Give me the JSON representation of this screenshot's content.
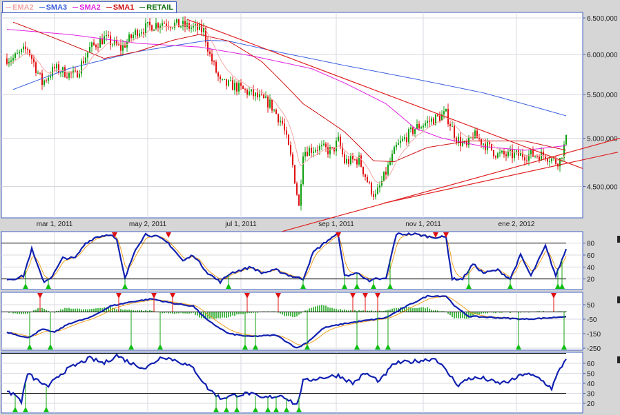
{
  "legend": [
    {
      "label": "EMA2",
      "color": "#f4a6a6"
    },
    {
      "label": "SMA3",
      "color": "#3a5ee0"
    },
    {
      "label": "SMA2",
      "color": "#e020e0"
    },
    {
      "label": "SMA1",
      "color": "#d01010"
    },
    {
      "label": "RETAIL",
      "color": "#107010"
    }
  ],
  "chart_data": [
    {
      "type": "candlestick",
      "title": "RETAIL",
      "yscale": "log",
      "ylim": [
        4200000,
        6580000
      ],
      "yticks": [
        {
          "v": 6500000,
          "label": "6.500,000"
        },
        {
          "v": 6000000,
          "label": "6.000,000"
        },
        {
          "v": 5500000,
          "label": "5.500,000"
        },
        {
          "v": 5000000,
          "label": "5.000,000"
        },
        {
          "v": 4500000,
          "label": "4.500,000"
        }
      ],
      "xticks": [
        {
          "at": 23,
          "label": "mar 1, 2011"
        },
        {
          "at": 68,
          "label": "may 2, 2011"
        },
        {
          "at": 113,
          "label": "jul 1, 2011"
        },
        {
          "at": 159,
          "label": "sep 1, 2011"
        },
        {
          "at": 201,
          "label": "nov 1, 2011"
        },
        {
          "at": 246,
          "label": "ene 2, 2012"
        }
      ],
      "bars": 270,
      "price_path": [
        [
          0,
          5950000
        ],
        [
          3,
          5950000
        ],
        [
          10,
          6080000
        ],
        [
          17,
          5640000
        ],
        [
          23,
          5820000
        ],
        [
          33,
          5730000
        ],
        [
          40,
          6080000
        ],
        [
          47,
          6220000
        ],
        [
          55,
          6080000
        ],
        [
          63,
          6320000
        ],
        [
          75,
          6440000
        ],
        [
          87,
          6380000
        ],
        [
          95,
          6320000
        ],
        [
          98,
          5990000
        ],
        [
          103,
          5640000
        ],
        [
          110,
          5600000
        ],
        [
          117,
          5520000
        ],
        [
          127,
          5390000
        ],
        [
          133,
          5160000
        ],
        [
          138,
          4710000
        ],
        [
          141,
          4300000
        ],
        [
          143,
          4860000
        ],
        [
          150,
          4900000
        ],
        [
          157,
          4860000
        ],
        [
          160,
          4970000
        ],
        [
          163,
          4750000
        ],
        [
          170,
          4770000
        ],
        [
          175,
          4500000
        ],
        [
          178,
          4400000
        ],
        [
          183,
          4640000
        ],
        [
          188,
          4900000
        ],
        [
          197,
          5110000
        ],
        [
          205,
          5200000
        ],
        [
          212,
          5270000
        ],
        [
          217,
          5000000
        ],
        [
          222,
          4900000
        ],
        [
          225,
          5040000
        ],
        [
          237,
          4820000
        ],
        [
          250,
          4820000
        ],
        [
          260,
          4820000
        ],
        [
          265,
          4750000
        ],
        [
          267,
          4770000
        ],
        [
          270,
          4980000
        ]
      ],
      "series": [
        {
          "name": "SMA3",
          "color": "#3a5ee0",
          "points": [
            [
              3,
              5560000
            ],
            [
              30,
              5820000
            ],
            [
              63,
              6040000
            ],
            [
              97,
              6190000
            ],
            [
              107,
              6180000
            ],
            [
              130,
              6040000
            ],
            [
              163,
              5860000
            ],
            [
              197,
              5690000
            ],
            [
              230,
              5520000
            ],
            [
              270,
              5250000
            ]
          ]
        },
        {
          "name": "SMA2",
          "color": "#e020e0",
          "points": [
            [
              0,
              6340000
            ],
            [
              30,
              6270000
            ],
            [
              63,
              6150000
            ],
            [
              93,
              6100000
            ],
            [
              117,
              5990000
            ],
            [
              147,
              5820000
            ],
            [
              163,
              5640000
            ],
            [
              183,
              5390000
            ],
            [
              197,
              5110000
            ],
            [
              210,
              5000000
            ],
            [
              230,
              4910000
            ],
            [
              250,
              4870000
            ],
            [
              270,
              4920000
            ]
          ]
        },
        {
          "name": "SMA1",
          "color": "#d01010",
          "points": [
            [
              3,
              6440000
            ],
            [
              23,
              6220000
            ],
            [
              47,
              5950000
            ],
            [
              63,
              6040000
            ],
            [
              80,
              6190000
            ],
            [
              93,
              6270000
            ],
            [
              107,
              6180000
            ],
            [
              123,
              5910000
            ],
            [
              143,
              5390000
            ],
            [
              163,
              5070000
            ],
            [
              177,
              4760000
            ],
            [
              187,
              4750000
            ],
            [
              203,
              4900000
            ],
            [
              223,
              4970000
            ],
            [
              250,
              4970000
            ],
            [
              270,
              4870000
            ]
          ]
        },
        {
          "name": "EMA2",
          "color": "#f4a6a6",
          "computed_from": "price_path",
          "period": 10
        }
      ],
      "trendlines": [
        {
          "from": [
            87,
            6480000
          ],
          "to": [
            278,
            4680000
          ],
          "color": "#e02020"
        },
        {
          "from": [
            133,
            4080000
          ],
          "to": [
            296,
            5000000
          ],
          "color": "#e02020"
        },
        {
          "from": [
            182,
            4340000
          ],
          "to": [
            295,
            4850000
          ],
          "color": "#e02020"
        }
      ]
    },
    {
      "type": "line",
      "name": "oscillator-1",
      "ylim": [
        0,
        100
      ],
      "yticks": [
        {
          "v": 80,
          "label": "80"
        },
        {
          "v": 60,
          "label": "60"
        },
        {
          "v": 40,
          "label": "40"
        },
        {
          "v": 20,
          "label": "20"
        }
      ],
      "hlines": [
        80,
        20
      ],
      "points": [
        [
          0,
          20
        ],
        [
          3,
          20
        ],
        [
          8,
          25
        ],
        [
          12,
          70
        ],
        [
          15,
          40
        ],
        [
          18,
          15
        ],
        [
          22,
          25
        ],
        [
          27,
          55
        ],
        [
          33,
          55
        ],
        [
          38,
          80
        ],
        [
          43,
          90
        ],
        [
          50,
          95
        ],
        [
          53,
          85
        ],
        [
          57,
          20
        ],
        [
          62,
          70
        ],
        [
          67,
          95
        ],
        [
          73,
          90
        ],
        [
          78,
          80
        ],
        [
          85,
          50
        ],
        [
          90,
          60
        ],
        [
          97,
          30
        ],
        [
          103,
          15
        ],
        [
          108,
          30
        ],
        [
          113,
          35
        ],
        [
          118,
          40
        ],
        [
          123,
          30
        ],
        [
          130,
          35
        ],
        [
          137,
          25
        ],
        [
          143,
          20
        ],
        [
          148,
          65
        ],
        [
          155,
          85
        ],
        [
          160,
          95
        ],
        [
          163,
          25
        ],
        [
          170,
          30
        ],
        [
          175,
          15
        ],
        [
          178,
          20
        ],
        [
          183,
          20
        ],
        [
          188,
          95
        ],
        [
          197,
          95
        ],
        [
          205,
          90
        ],
        [
          212,
          90
        ],
        [
          215,
          20
        ],
        [
          220,
          20
        ],
        [
          225,
          45
        ],
        [
          230,
          30
        ],
        [
          237,
          35
        ],
        [
          243,
          20
        ],
        [
          248,
          60
        ],
        [
          253,
          25
        ],
        [
          260,
          75
        ],
        [
          265,
          25
        ],
        [
          270,
          70
        ]
      ],
      "signal_period": 4,
      "sell_markers": [
        52,
        78,
        160,
        207,
        212
      ],
      "buy_markers": [
        9,
        20,
        57,
        107,
        143,
        163,
        169,
        177,
        185,
        223,
        243,
        266,
        268
      ]
    },
    {
      "type": "line",
      "name": "oscillator-2",
      "ylim": [
        -265,
        135
      ],
      "yticks": [
        {
          "v": 50,
          "label": "50"
        },
        {
          "v": -50,
          "label": "-50"
        },
        {
          "v": -150,
          "label": "-150"
        },
        {
          "v": -250,
          "label": "-250"
        }
      ],
      "hlines": [
        0
      ],
      "points": [
        [
          0,
          -140
        ],
        [
          3,
          -150
        ],
        [
          10,
          -180
        ],
        [
          17,
          -120
        ],
        [
          23,
          -140
        ],
        [
          30,
          -80
        ],
        [
          40,
          -40
        ],
        [
          50,
          40
        ],
        [
          60,
          70
        ],
        [
          70,
          90
        ],
        [
          80,
          60
        ],
        [
          90,
          40
        ],
        [
          97,
          -60
        ],
        [
          107,
          -150
        ],
        [
          117,
          -170
        ],
        [
          130,
          -160
        ],
        [
          140,
          -250
        ],
        [
          145,
          -210
        ],
        [
          153,
          -110
        ],
        [
          163,
          -80
        ],
        [
          173,
          -60
        ],
        [
          183,
          -40
        ],
        [
          193,
          40
        ],
        [
          203,
          110
        ],
        [
          212,
          110
        ],
        [
          217,
          30
        ],
        [
          223,
          -30
        ],
        [
          237,
          -40
        ],
        [
          250,
          -50
        ],
        [
          263,
          -40
        ],
        [
          270,
          -30
        ]
      ],
      "signal_period": 8,
      "sell_markers": [
        16,
        54,
        71,
        80,
        116,
        131,
        167,
        173,
        179,
        264
      ],
      "buy_markers": [
        11,
        21,
        60,
        74,
        115,
        120,
        145,
        169,
        179,
        184,
        247,
        269
      ]
    },
    {
      "type": "line",
      "name": "oscillator-3",
      "ylim": [
        10,
        70
      ],
      "yticks": [
        {
          "v": 60,
          "label": "60"
        },
        {
          "v": 50,
          "label": "50"
        },
        {
          "v": 40,
          "label": "40"
        },
        {
          "v": 30,
          "label": "30"
        },
        {
          "v": 20,
          "label": "20"
        }
      ],
      "hlines": [
        70,
        30
      ],
      "points": [
        [
          0,
          30
        ],
        [
          3,
          30
        ],
        [
          7,
          22
        ],
        [
          10,
          50
        ],
        [
          13,
          45
        ],
        [
          17,
          40
        ],
        [
          20,
          35
        ],
        [
          23,
          45
        ],
        [
          30,
          55
        ],
        [
          40,
          65
        ],
        [
          47,
          60
        ],
        [
          53,
          68
        ],
        [
          60,
          60
        ],
        [
          67,
          55
        ],
        [
          75,
          67
        ],
        [
          83,
          62
        ],
        [
          90,
          55
        ],
        [
          97,
          35
        ],
        [
          103,
          25
        ],
        [
          110,
          28
        ],
        [
          117,
          30
        ],
        [
          123,
          25
        ],
        [
          133,
          28
        ],
        [
          140,
          18
        ],
        [
          143,
          42
        ],
        [
          150,
          45
        ],
        [
          160,
          48
        ],
        [
          167,
          40
        ],
        [
          173,
          50
        ],
        [
          180,
          42
        ],
        [
          187,
          60
        ],
        [
          197,
          62
        ],
        [
          207,
          65
        ],
        [
          213,
          50
        ],
        [
          218,
          38
        ],
        [
          223,
          45
        ],
        [
          230,
          45
        ],
        [
          237,
          40
        ],
        [
          243,
          42
        ],
        [
          250,
          50
        ],
        [
          257,
          45
        ],
        [
          263,
          35
        ],
        [
          266,
          50
        ],
        [
          270,
          65
        ]
      ],
      "buy_markers": [
        4,
        9,
        19,
        101,
        106,
        111,
        120,
        126,
        130,
        135,
        141
      ]
    }
  ]
}
